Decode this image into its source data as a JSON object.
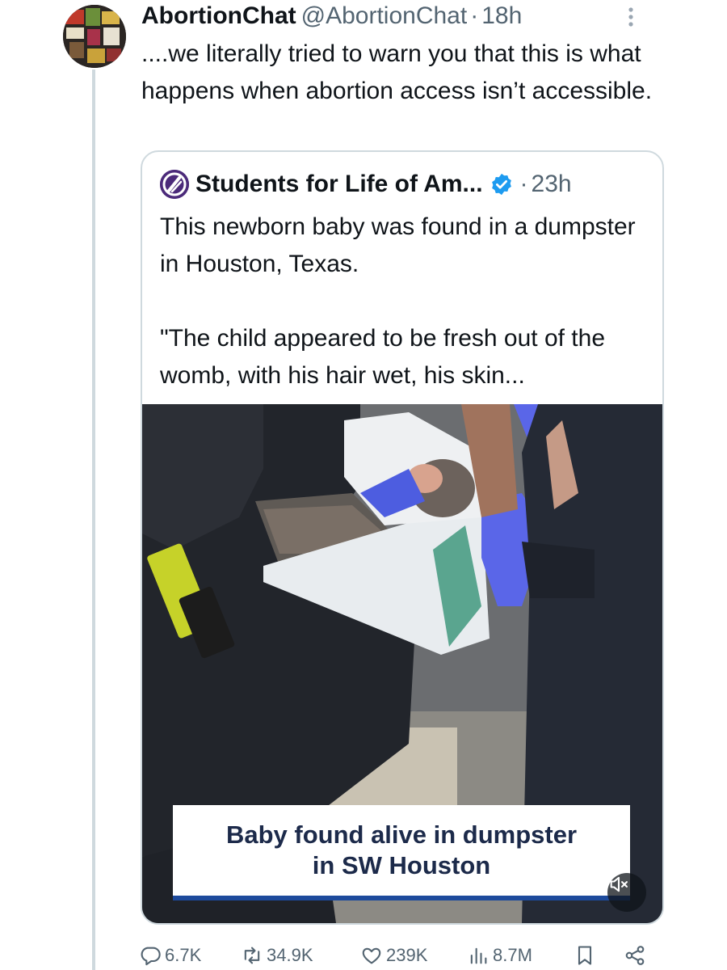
{
  "tweet": {
    "display_name": "AbortionChat",
    "handle": "@AbortionChat",
    "separator": "·",
    "time": "18h",
    "text": "....we literally tried to warn you that this is what happens when abortion access isn’t accessible.",
    "avatar_icon": "avatar-collage"
  },
  "quote": {
    "display_name": "Students for Life of Am...",
    "verified_icon": "verified-badge-icon",
    "separator": "·",
    "time": "23h",
    "text": "This newborn baby was found in a dumpster in Houston, Texas.\n\n\"The child appeared to be fresh out of the womb, with his hair wet, his skin...",
    "media": {
      "caption_line1": "Baby found alive in dumpster",
      "caption_line2": "in SW Houston",
      "mute_icon": "speaker-muted-icon"
    }
  },
  "actions": {
    "replies": "6.7K",
    "reposts": "34.9K",
    "likes": "239K",
    "views": "8.7M"
  },
  "colors": {
    "text": "#0f1419",
    "secondary": "#536471",
    "border": "#cfd9de",
    "verified": "#1d9bf0",
    "caption_accent": "#1d4a9c"
  }
}
